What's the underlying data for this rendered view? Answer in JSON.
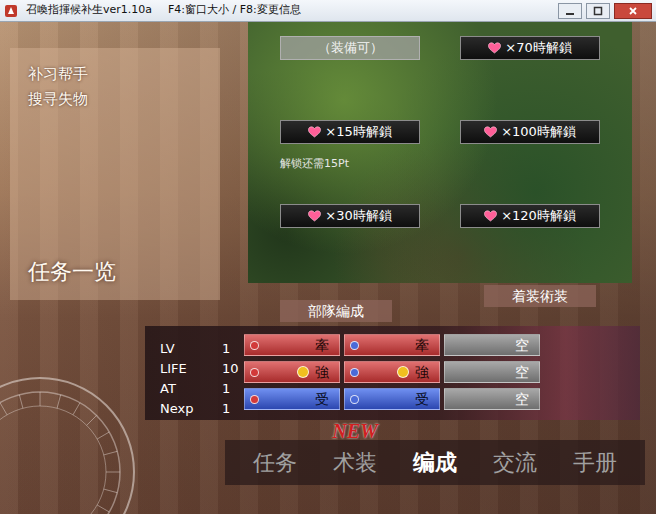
{
  "window": {
    "title": "召喚指揮候补生ver1.10a",
    "hotkeys": "F4:窗口大小 / F8:変更信息"
  },
  "side_menu": {
    "items": [
      "补习帮手",
      "搜寻失物"
    ],
    "heading": "任务一览"
  },
  "unlocks": [
    {
      "label": "（装備可）",
      "kind": "equippable"
    },
    {
      "label": "×70時解鎖",
      "kind": "locked"
    },
    {
      "label": "×15時解鎖",
      "kind": "locked",
      "note": "解锁还需15Pt"
    },
    {
      "label": "×100時解鎖",
      "kind": "locked"
    },
    {
      "label": "×30時解鎖",
      "kind": "locked"
    },
    {
      "label": "×120時解鎖",
      "kind": "locked"
    }
  ],
  "section_labels": {
    "formation": "部隊編成",
    "outfit": "着装術装"
  },
  "stats": [
    {
      "label": "LV",
      "value": "1"
    },
    {
      "label": "LIFE",
      "value": "10"
    },
    {
      "label": "AT",
      "value": "1"
    },
    {
      "label": "Nexp",
      "value": "1"
    }
  ],
  "slots": [
    [
      {
        "label": "牽",
        "kind": "attack",
        "dots": [
          "#d23a3a"
        ]
      },
      {
        "label": "牽",
        "kind": "attack",
        "dots": [
          "#4a6ad8"
        ]
      },
      {
        "label": "空",
        "kind": "empty",
        "dots": []
      }
    ],
    [
      {
        "label": "強",
        "kind": "attack",
        "dots": [
          "#d23a3a",
          "#f0c020"
        ]
      },
      {
        "label": "強",
        "kind": "attack",
        "dots": [
          "#4a6ad8",
          "#f0c020"
        ]
      },
      {
        "label": "空",
        "kind": "empty",
        "dots": []
      }
    ],
    [
      {
        "label": "受",
        "kind": "defense",
        "dots": [
          "#d23a3a"
        ]
      },
      {
        "label": "受",
        "kind": "defense",
        "dots": [
          "#4a6ad8"
        ]
      },
      {
        "label": "空",
        "kind": "empty",
        "dots": []
      }
    ]
  ],
  "nav": {
    "tabs": [
      {
        "label": "任务",
        "selected": false
      },
      {
        "label": "术装",
        "selected": false,
        "badge": "NEW"
      },
      {
        "label": "编成",
        "selected": true
      },
      {
        "label": "交流",
        "selected": false
      },
      {
        "label": "手册",
        "selected": false
      }
    ]
  }
}
